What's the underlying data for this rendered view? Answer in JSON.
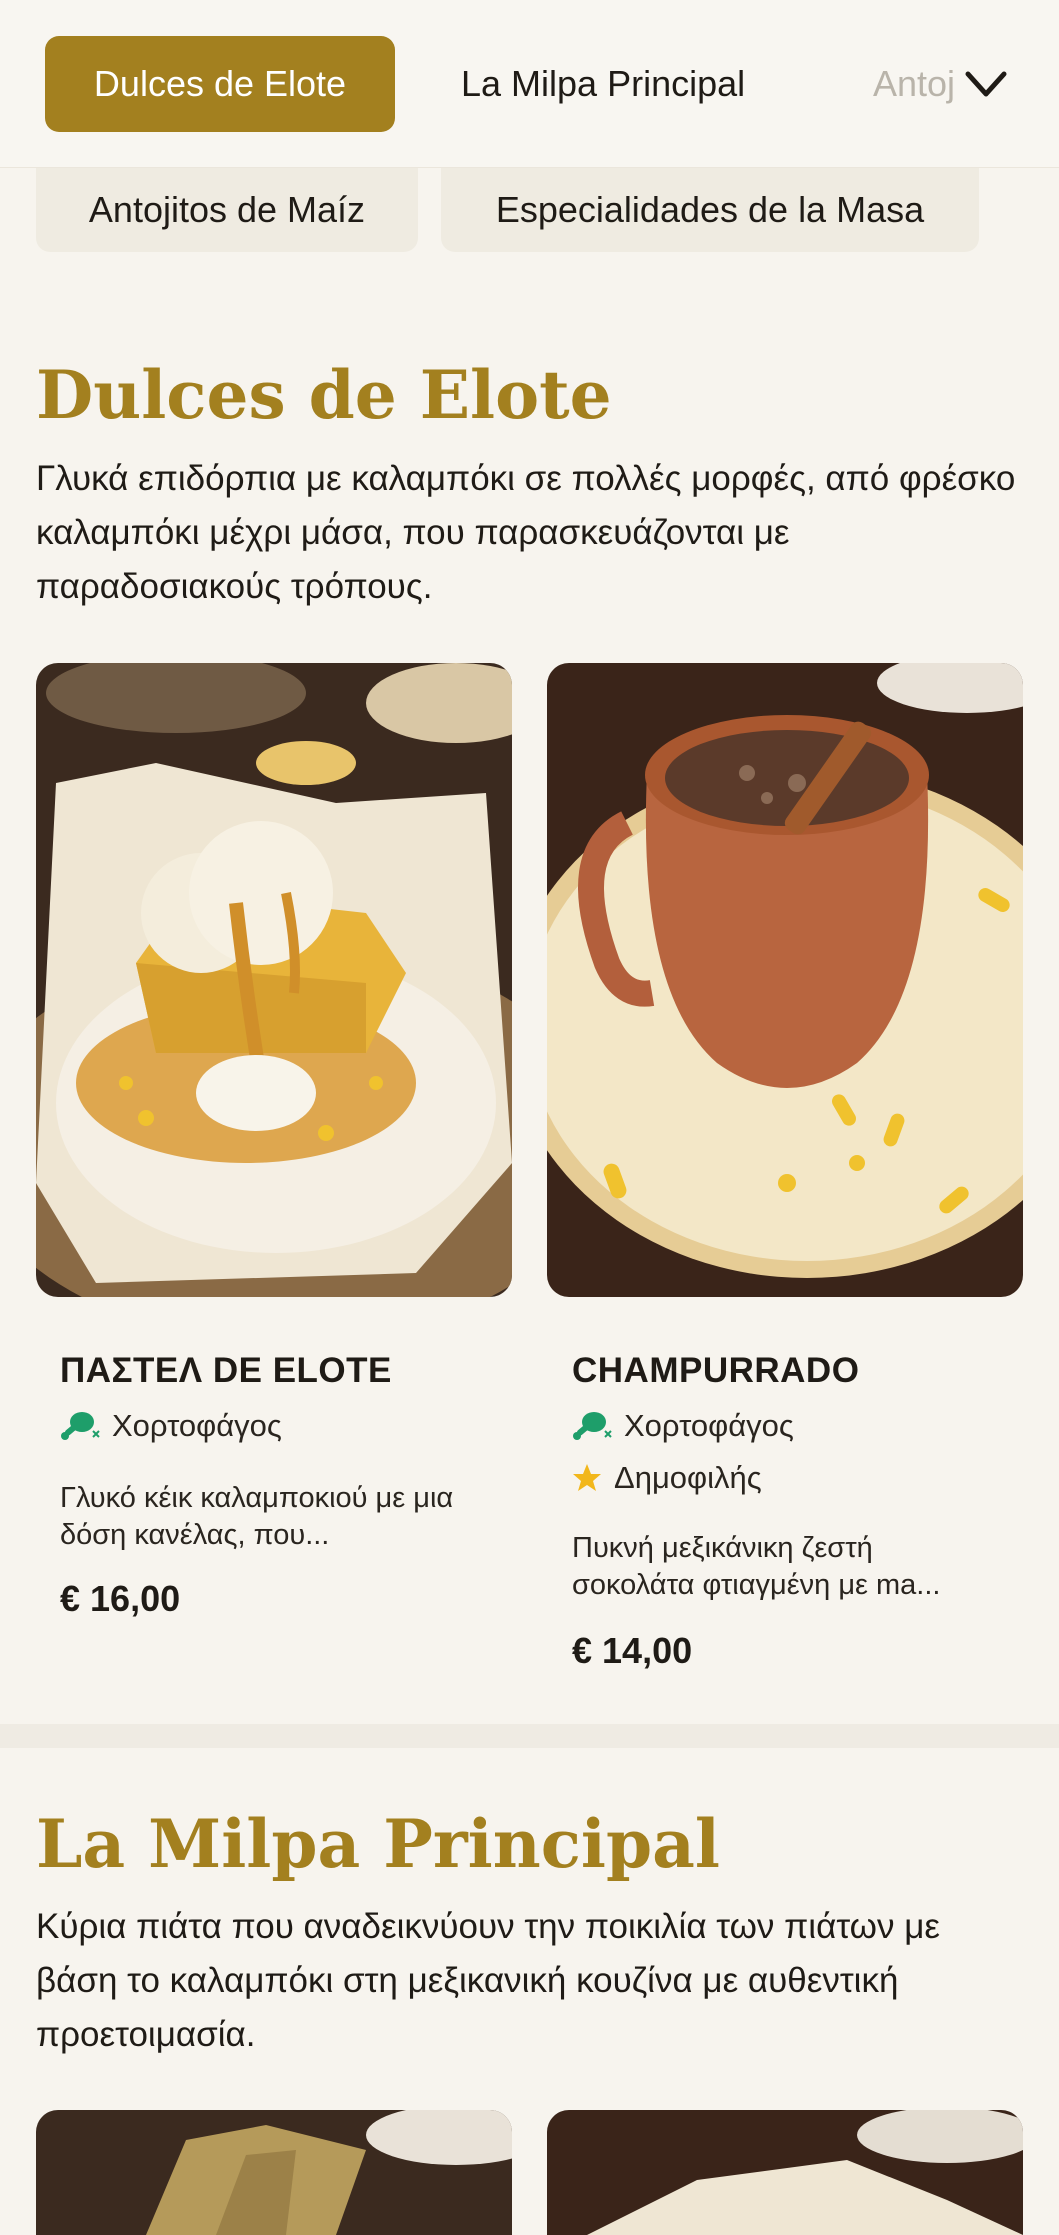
{
  "nav": {
    "tabs": [
      {
        "label": "Dulces de Elote",
        "active": true
      },
      {
        "label": "La Milpa Principal",
        "active": false
      },
      {
        "label": "Antojitos de Maíz",
        "active": false
      }
    ],
    "chips": [
      "Antojitos de Maíz",
      "Especialidades de la Masa"
    ],
    "expand_icon": "chevron-down-icon"
  },
  "sections": [
    {
      "title": "Dulces de Elote",
      "description": "Γλυκά επιδόρπια με καλαμπόκι σε πολλές μορφές, από φρέσκο καλαμπόκι μέχρι μάσα, που παρασκευάζονται με παραδοσιακούς τρόπους.",
      "items": [
        {
          "name": "ΠΑΣΤΕΛ DE ELOTE",
          "tags": [
            "Χορτοφάγος"
          ],
          "description": "Γλυκό κέικ καλαμποκιού με μια δόση κανέλας, που...",
          "price": "€ 16,00"
        },
        {
          "name": "CHAMPURRADO",
          "tags": [
            "Χορτοφάγος",
            "Δημοφιλής"
          ],
          "description": "Πυκνή μεξικάνικη ζεστή σοκολάτα φτιαγμένη με ma...",
          "price": "€ 14,00"
        }
      ]
    },
    {
      "title": "La Milpa Principal",
      "description": "Κύρια πιάτα που αναδεικνύουν την ποικιλία των πιάτων με βάση το καλαμπόκι στη μεξικανική κουζίνα με αυθεντική προετοιμασία."
    }
  ],
  "colors": {
    "accent": "#a3801f",
    "background": "#f7f4ee",
    "vegetarian_icon": "#1e9e6a",
    "popular_icon": "#f2b71b"
  },
  "icons": {
    "vegetarian": "vegetarian-drumstick-icon",
    "popular": "star-icon"
  }
}
